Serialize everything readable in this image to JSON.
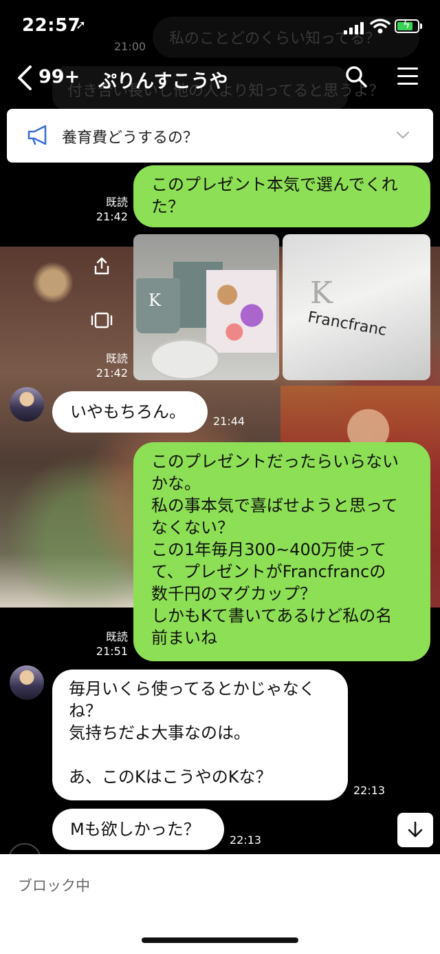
{
  "status": {
    "time": "22:57"
  },
  "background": {
    "ghost_text_1": "私のことどのくらい知ってる？",
    "ghost_text_2": "付き合い長いし他の人より知ってると思うよ？",
    "ghost_time": "21:00"
  },
  "header": {
    "back_count": "99+",
    "title": "ぷりんすこうや"
  },
  "announcement": {
    "text": "養育費どうするの？"
  },
  "messages": [
    {
      "id": "m1",
      "side": "right",
      "text": [
        "このプレゼント本気で選んでくれ",
        "た？"
      ],
      "read": "既読",
      "time": "21:42"
    },
    {
      "id": "m2",
      "side": "right",
      "type": "photos",
      "photos": [
        {
          "mug_letter": "K"
        },
        {
          "bag_letter": "K",
          "brand": "Francfranc"
        }
      ],
      "read": "既読",
      "time": "21:42"
    },
    {
      "id": "m3",
      "side": "left",
      "text": [
        "いやもちろん。"
      ],
      "time": "21:44"
    },
    {
      "id": "m4",
      "side": "right",
      "text": [
        "このプレゼントだったらいらない",
        "かな。",
        "私の事本気で喜ばせようと思って",
        "なくない？",
        "この1年毎月300~400万使って",
        "て、プレゼントがFrancfrancの",
        "数千円のマグカップ？",
        "しかもKて書いてあるけど私の名",
        "前まいね"
      ],
      "read": "既読",
      "time": "21:51"
    },
    {
      "id": "m5",
      "side": "left",
      "text": [
        "毎月いくら使ってるとかじゃなく",
        "ね？",
        "気持ちだよ大事なのは。",
        "",
        "あ、このKはこうやのKな？"
      ],
      "time": "22:13"
    },
    {
      "id": "m6",
      "side": "left",
      "text": [
        "Mも欲しかった？"
      ],
      "time": "22:13"
    }
  ],
  "footer": {
    "status_text": "ブロック中"
  },
  "icons": [
    "location-arrow-icon",
    "signal-icon",
    "wifi-icon",
    "battery-icon",
    "back-chevron-icon",
    "search-icon",
    "menu-icon",
    "megaphone-icon",
    "chevron-down-icon",
    "share-icon",
    "frame-icon",
    "scroll-down-icon"
  ],
  "colors": {
    "my_bubble": "#8de055",
    "their_bubble": "#ffffff",
    "background": "#000000"
  }
}
